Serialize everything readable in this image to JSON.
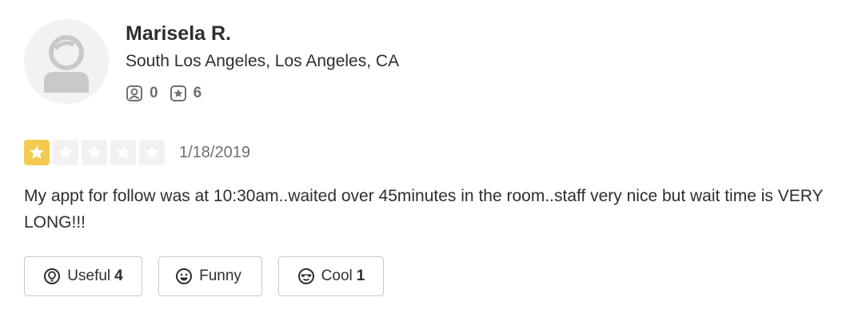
{
  "user": {
    "name": "Marisela R.",
    "location": "South Los Angeles, Los Angeles, CA",
    "friends_count": "0",
    "reviews_count": "6"
  },
  "review": {
    "rating": 1,
    "max_rating": 5,
    "date": "1/18/2019",
    "text": "My appt for follow was at 10:30am..waited over 45minutes in the room..staff very nice but wait time is VERY LONG!!!"
  },
  "actions": {
    "useful_label": "Useful",
    "useful_count": "4",
    "funny_label": "Funny",
    "funny_count": "",
    "cool_label": "Cool",
    "cool_count": "1"
  },
  "colors": {
    "star_filled": "#f4cb50",
    "star_empty": "#f1f1f1",
    "text": "#2d2e2f",
    "muted": "#6e7072"
  },
  "icons": {
    "avatar": "default-user-avatar-icon",
    "friends": "friends-icon",
    "reviews": "review-star-icon",
    "useful": "lightbulb-icon",
    "funny": "smile-icon",
    "cool": "sunglasses-icon"
  }
}
